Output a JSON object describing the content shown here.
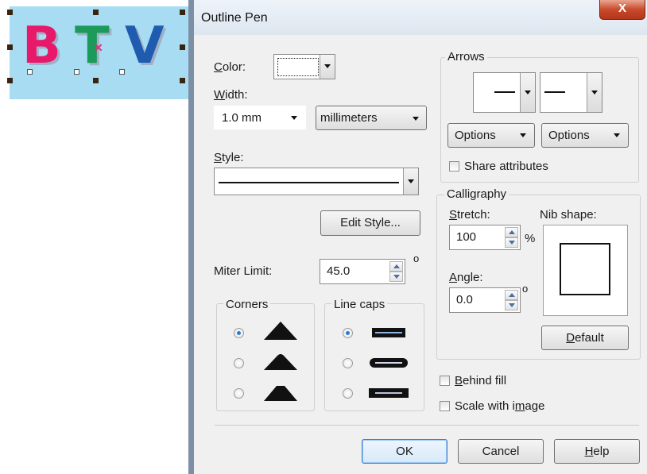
{
  "preview": {
    "text_b": "B",
    "text_t": "T",
    "text_v": "V"
  },
  "dialog": {
    "title": "Outline Pen",
    "close_label": "X",
    "color_label": "Color:",
    "width_label": "Width:",
    "width_value": "1.0 mm",
    "units_value": "millimeters",
    "style_label": "Style:",
    "edit_style_label": "Edit Style...",
    "miter_label": "Miter Limit:",
    "miter_value": "45.0",
    "degree_symbol": "o",
    "corners_label": "Corners",
    "linecaps_label": "Line caps",
    "arrows_label": "Arrows",
    "options_left_label": "Options",
    "options_right_label": "Options",
    "share_attributes_label": "Share attributes",
    "calligraphy_label": "Calligraphy",
    "stretch_label": "Stretch:",
    "stretch_value": "100",
    "percent_symbol": "%",
    "nib_shape_label": "Nib shape:",
    "angle_label": "Angle:",
    "angle_value": "0.0",
    "default_label": "Default",
    "behind_fill_label": "Behind fill",
    "scale_with_image_label": "Scale with image",
    "ok_label": "OK",
    "cancel_label": "Cancel",
    "help_label": "Help"
  },
  "colors": {
    "accent": "#3c7fd1",
    "close": "#c94a2c"
  }
}
